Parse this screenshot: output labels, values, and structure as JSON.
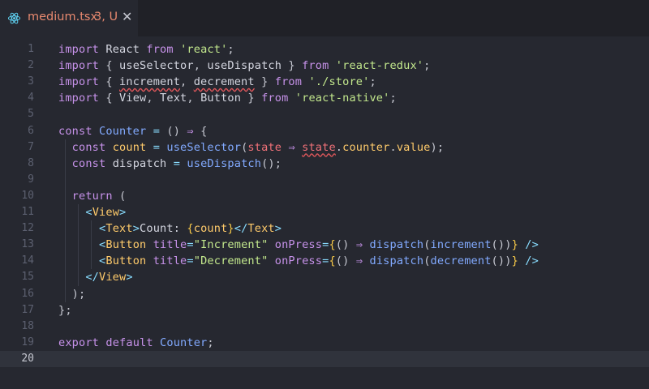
{
  "tab": {
    "filename": "medium.tsx",
    "status": "3, U",
    "close_glyph": "✕",
    "accent_color": "#e8896f",
    "icon": "react-icon"
  },
  "editor": {
    "current_line": 20,
    "lines": [
      {
        "n": "1",
        "tokens": [
          [
            "kw",
            "import"
          ],
          [
            "pun",
            " "
          ],
          [
            "id",
            "React"
          ],
          [
            "pun",
            " "
          ],
          [
            "kw",
            "from"
          ],
          [
            "pun",
            " "
          ],
          [
            "str",
            "'react'"
          ],
          [
            "pun",
            ";"
          ]
        ]
      },
      {
        "n": "2",
        "tokens": [
          [
            "kw",
            "import"
          ],
          [
            "pun",
            " { "
          ],
          [
            "id",
            "useSelector"
          ],
          [
            "pun",
            ", "
          ],
          [
            "id",
            "useDispatch"
          ],
          [
            "pun",
            " } "
          ],
          [
            "kw",
            "from"
          ],
          [
            "pun",
            " "
          ],
          [
            "str",
            "'react-redux'"
          ],
          [
            "pun",
            ";"
          ]
        ]
      },
      {
        "n": "3",
        "tokens": [
          [
            "kw",
            "import"
          ],
          [
            "pun",
            " { "
          ],
          [
            "id err",
            "increment"
          ],
          [
            "pun",
            ", "
          ],
          [
            "id err",
            "decrement"
          ],
          [
            "pun",
            " } "
          ],
          [
            "kw",
            "from"
          ],
          [
            "pun",
            " "
          ],
          [
            "str",
            "'./store'"
          ],
          [
            "pun",
            ";"
          ]
        ]
      },
      {
        "n": "4",
        "tokens": [
          [
            "kw",
            "import"
          ],
          [
            "pun",
            " { "
          ],
          [
            "id",
            "View"
          ],
          [
            "pun",
            ", "
          ],
          [
            "id",
            "Text"
          ],
          [
            "pun",
            ", "
          ],
          [
            "id",
            "Button"
          ],
          [
            "pun",
            " } "
          ],
          [
            "kw",
            "from"
          ],
          [
            "pun",
            " "
          ],
          [
            "str",
            "'react-native'"
          ],
          [
            "pun",
            ";"
          ]
        ]
      },
      {
        "n": "5",
        "tokens": []
      },
      {
        "n": "6",
        "tokens": [
          [
            "kw",
            "const"
          ],
          [
            "pun",
            " "
          ],
          [
            "fn",
            "Counter"
          ],
          [
            "pun",
            " "
          ],
          [
            "op",
            "="
          ],
          [
            "pun",
            " () "
          ],
          [
            "kw",
            "⇒"
          ],
          [
            "pun",
            " {"
          ]
        ]
      },
      {
        "n": "7",
        "tokens": [
          [
            "pun",
            "  "
          ],
          [
            "kw",
            "const"
          ],
          [
            "pun",
            " "
          ],
          [
            "prop",
            "count"
          ],
          [
            "pun",
            " "
          ],
          [
            "op",
            "="
          ],
          [
            "pun",
            " "
          ],
          [
            "fn",
            "useSelector"
          ],
          [
            "pun",
            "("
          ],
          [
            "var",
            "state"
          ],
          [
            "pun",
            " "
          ],
          [
            "kw",
            "⇒"
          ],
          [
            "pun",
            " "
          ],
          [
            "var err",
            "state"
          ],
          [
            "pun",
            "."
          ],
          [
            "prop",
            "counter"
          ],
          [
            "pun",
            "."
          ],
          [
            "prop",
            "value"
          ],
          [
            "pun",
            ");"
          ]
        ]
      },
      {
        "n": "8",
        "tokens": [
          [
            "pun",
            "  "
          ],
          [
            "kw",
            "const"
          ],
          [
            "pun",
            " "
          ],
          [
            "id",
            "dispatch"
          ],
          [
            "pun",
            " "
          ],
          [
            "op",
            "="
          ],
          [
            "pun",
            " "
          ],
          [
            "fn",
            "useDispatch"
          ],
          [
            "pun",
            "();"
          ]
        ]
      },
      {
        "n": "9",
        "tokens": []
      },
      {
        "n": "10",
        "tokens": [
          [
            "pun",
            "  "
          ],
          [
            "kw",
            "return"
          ],
          [
            "pun",
            " ("
          ]
        ]
      },
      {
        "n": "11",
        "tokens": [
          [
            "pun",
            "    "
          ],
          [
            "op",
            "<"
          ],
          [
            "cls",
            "View"
          ],
          [
            "op",
            ">"
          ]
        ]
      },
      {
        "n": "12",
        "tokens": [
          [
            "pun",
            "      "
          ],
          [
            "op",
            "<"
          ],
          [
            "cls",
            "Text"
          ],
          [
            "op",
            ">"
          ],
          [
            "id",
            "Count: "
          ],
          [
            "brace",
            "{"
          ],
          [
            "prop",
            "count"
          ],
          [
            "brace",
            "}"
          ],
          [
            "op",
            "</"
          ],
          [
            "cls",
            "Text"
          ],
          [
            "op",
            ">"
          ]
        ]
      },
      {
        "n": "13",
        "tokens": [
          [
            "pun",
            "      "
          ],
          [
            "op",
            "<"
          ],
          [
            "cls",
            "Button"
          ],
          [
            "pun",
            " "
          ],
          [
            "attr",
            "title"
          ],
          [
            "op",
            "="
          ],
          [
            "str",
            "\"Increment\""
          ],
          [
            "pun",
            " "
          ],
          [
            "attr",
            "onPress"
          ],
          [
            "op",
            "="
          ],
          [
            "brace",
            "{"
          ],
          [
            "pun",
            "() "
          ],
          [
            "kw",
            "⇒"
          ],
          [
            "pun",
            " "
          ],
          [
            "fn",
            "dispatch"
          ],
          [
            "pun",
            "("
          ],
          [
            "fn",
            "increment"
          ],
          [
            "pun",
            "())"
          ],
          [
            "brace",
            "}"
          ],
          [
            "pun",
            " "
          ],
          [
            "op",
            "/>"
          ]
        ]
      },
      {
        "n": "14",
        "tokens": [
          [
            "pun",
            "      "
          ],
          [
            "op",
            "<"
          ],
          [
            "cls",
            "Button"
          ],
          [
            "pun",
            " "
          ],
          [
            "attr",
            "title"
          ],
          [
            "op",
            "="
          ],
          [
            "str",
            "\"Decrement\""
          ],
          [
            "pun",
            " "
          ],
          [
            "attr",
            "onPress"
          ],
          [
            "op",
            "="
          ],
          [
            "brace",
            "{"
          ],
          [
            "pun",
            "() "
          ],
          [
            "kw",
            "⇒"
          ],
          [
            "pun",
            " "
          ],
          [
            "fn",
            "dispatch"
          ],
          [
            "pun",
            "("
          ],
          [
            "fn",
            "decrement"
          ],
          [
            "pun",
            "())"
          ],
          [
            "brace",
            "}"
          ],
          [
            "pun",
            " "
          ],
          [
            "op",
            "/>"
          ]
        ]
      },
      {
        "n": "15",
        "tokens": [
          [
            "pun",
            "    "
          ],
          [
            "op",
            "</"
          ],
          [
            "cls",
            "View"
          ],
          [
            "op",
            ">"
          ]
        ]
      },
      {
        "n": "16",
        "tokens": [
          [
            "pun",
            "  );"
          ]
        ]
      },
      {
        "n": "17",
        "tokens": [
          [
            "pun",
            "};"
          ]
        ]
      },
      {
        "n": "18",
        "tokens": []
      },
      {
        "n": "19",
        "tokens": [
          [
            "kw",
            "export"
          ],
          [
            "pun",
            " "
          ],
          [
            "kw",
            "default"
          ],
          [
            "pun",
            " "
          ],
          [
            "fn",
            "Counter"
          ],
          [
            "pun",
            ";"
          ]
        ]
      },
      {
        "n": "20",
        "tokens": []
      }
    ]
  }
}
